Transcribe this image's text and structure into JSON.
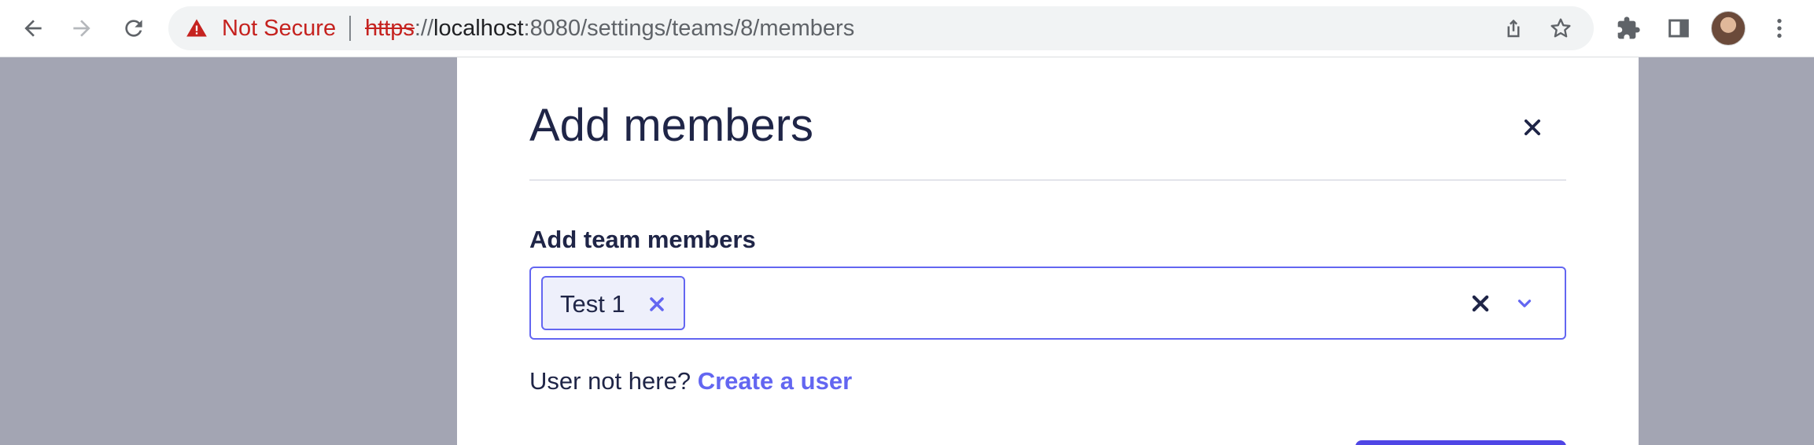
{
  "browser": {
    "security_label": "Not Secure",
    "url_scheme": "https",
    "url_rest": "://",
    "url_host": "localhost",
    "url_path": ":8080/settings/teams/8/members"
  },
  "modal": {
    "title": "Add members",
    "field_label": "Add team members",
    "selected_members": [
      "Test 1"
    ],
    "helper_text": "User not here?",
    "helper_link": "Create a user"
  },
  "colors": {
    "accent": "#6366f1",
    "text": "#1f2547",
    "overlay": "#a3a5b3",
    "warning": "#c5221f"
  }
}
